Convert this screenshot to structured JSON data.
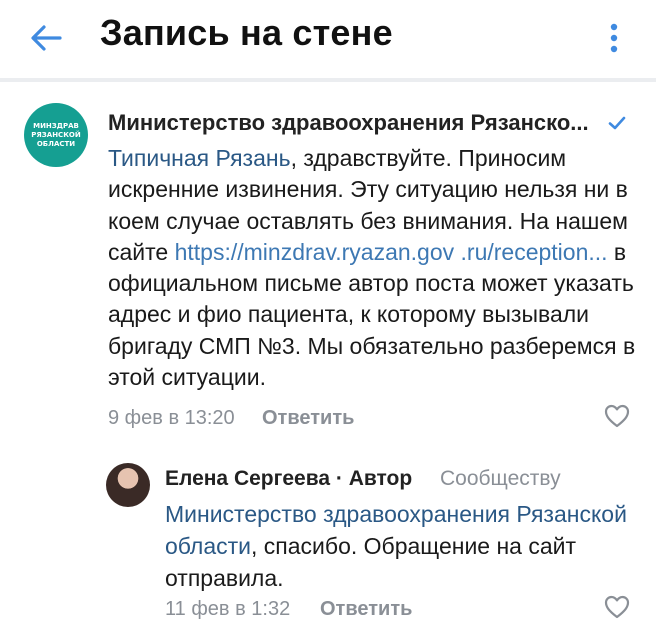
{
  "header": {
    "title": "Запись на стене",
    "back_icon": "arrow-left-icon",
    "menu_icon": "more-vertical-icon"
  },
  "comment": {
    "author": "Министерство здравоохранения Рязанско...",
    "avatar_lines": [
      "МИНЗДРАВ",
      "РЯЗАНСКОЙ",
      "ОБЛАСТИ"
    ],
    "mention": "Типичная Рязань",
    "text_1": ", здравствуйте. Приносим искренние извинения. Эту ситуацию нельзя ни в коем случае оставлять без внимания. На нашем сайте ",
    "url": "https://minzdrav.ryazan.gov .ru/reception...",
    "text_2": " в официальном письме автор поста может указать адрес и фио пациента, к которому вызывали бригаду СМП №3. Мы обязательно разберемся в этой ситуации.",
    "time": "9 фев в 13:20",
    "reply_label": "Ответить"
  },
  "reply": {
    "author": "Елена Сергеева · Автор",
    "to": "Сообществу",
    "mention": "Министерство здравоохранения Рязанской области",
    "text": ", спасибо. Обращение на сайт отправила.",
    "time": "11 фев в 1:32",
    "reply_label": "Ответить"
  },
  "colors": {
    "accent": "#3f8ae0",
    "link": "#2a5885",
    "meta": "#8a8f96",
    "avatar_bg": "#159f92"
  }
}
